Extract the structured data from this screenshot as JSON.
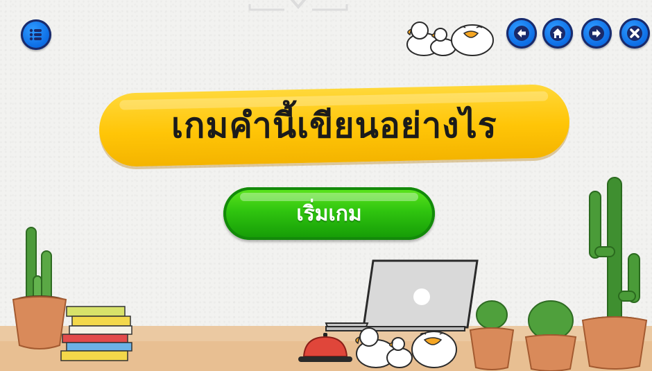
{
  "game": {
    "title": "เกมคำนี้เขียนอย่างไร",
    "start_label": "เริ่มเกม"
  },
  "nav": {
    "menu_icon": "list-icon",
    "back_icon": "arrow-left-icon",
    "home_icon": "home-icon",
    "forward_icon": "arrow-right-icon",
    "close_icon": "close-icon"
  },
  "colors": {
    "title_pill": "#ffc507",
    "start_button": "#2fc40f",
    "nav_button": "#0e6fe6",
    "desk": "#ebc9a2"
  }
}
